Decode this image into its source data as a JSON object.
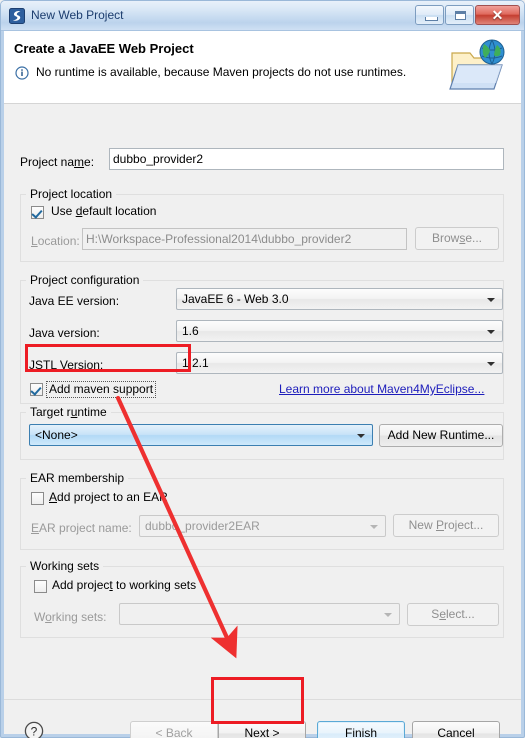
{
  "window": {
    "title": "New Web Project",
    "icon": "myeclipse-logo-icon",
    "buttons": {
      "minimize": "minimize-button",
      "maximize": "maximize-button",
      "close": "close-button"
    }
  },
  "header": {
    "title": "Create a JavaEE Web Project",
    "message": "No runtime is available, because Maven projects do not use runtimes.",
    "icon": "info-icon",
    "graphic": "web-project-folder-globe-icon"
  },
  "form": {
    "project_name": {
      "label": "Project name:",
      "value": "dubbo_provider2"
    },
    "project_location": {
      "group_label": "Project location",
      "use_default_label": "Use default location",
      "use_default_checked": true,
      "location_label": "Location:",
      "location_value": "H:\\Workspace-Professional2014\\dubbo_provider2",
      "browse_label": "Browse..."
    },
    "project_configuration": {
      "group_label": "Project configuration",
      "javaee_version_label": "Java EE version:",
      "javaee_version_value": "JavaEE 6 - Web 3.0",
      "java_version_label": "Java version:",
      "java_version_value": "1.6",
      "jstl_version_label": "JSTL Version:",
      "jstl_version_value": "1.2.1",
      "add_maven_label": "Add maven support",
      "add_maven_checked": true,
      "learn_more_link": "Learn more about Maven4MyEclipse..."
    },
    "target_runtime": {
      "group_label": "Target runtime",
      "value": "<None>",
      "add_new_runtime_label": "Add New Runtime..."
    },
    "ear_membership": {
      "group_label": "EAR membership",
      "add_to_ear_label": "Add project to an EAR",
      "add_to_ear_checked": false,
      "ear_project_name_label": "EAR project name:",
      "ear_project_name_value": "dubbo_provider2EAR",
      "new_project_label": "New Project..."
    },
    "working_sets": {
      "group_label": "Working sets",
      "add_to_working_sets_label": "Add project to working sets",
      "add_to_working_sets_checked": false,
      "working_sets_label": "Working sets:",
      "working_sets_value": "",
      "select_label": "Select..."
    }
  },
  "footer": {
    "help_icon": "help-question-icon",
    "back_label": "< Back",
    "back_enabled": false,
    "next_label": "Next >",
    "finish_label": "Finish",
    "cancel_label": "Cancel"
  },
  "annotations": {
    "highlight_color": "#ed1c24",
    "boxes": [
      {
        "name": "add-maven-support-highlight"
      },
      {
        "name": "next-button-highlight"
      }
    ],
    "arrow": {
      "name": "pointer-arrow",
      "from": "add maven support",
      "to": "Next button"
    }
  }
}
